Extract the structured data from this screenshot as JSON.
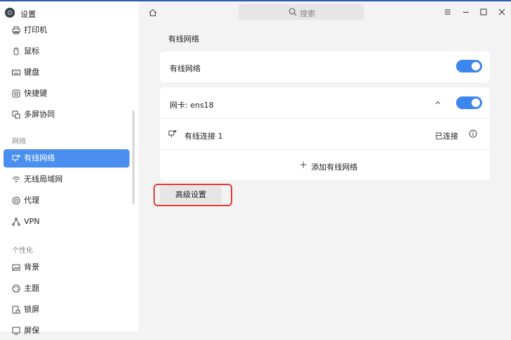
{
  "app": {
    "title": "设置",
    "icon": "settings-app-icon"
  },
  "search": {
    "placeholder": "搜索",
    "icon": "search-icon"
  },
  "sidebar": {
    "items_top": [
      {
        "label": "打印机",
        "icon": "printer-icon"
      },
      {
        "label": "鼠标",
        "icon": "mouse-icon"
      },
      {
        "label": "键盘",
        "icon": "keyboard-icon"
      },
      {
        "label": "快捷键",
        "icon": "shortcut-icon"
      },
      {
        "label": "多屏协同",
        "icon": "multi-screen-icon"
      }
    ],
    "section_network": "网络",
    "items_network": [
      {
        "label": "有线网络",
        "icon": "wired-network-icon",
        "active": true
      },
      {
        "label": "无线局域网",
        "icon": "wifi-icon"
      },
      {
        "label": "代理",
        "icon": "proxy-icon"
      },
      {
        "label": "VPN",
        "icon": "vpn-icon"
      }
    ],
    "section_personal": "个性化",
    "items_personal": [
      {
        "label": "背景",
        "icon": "background-icon"
      },
      {
        "label": "主题",
        "icon": "theme-icon"
      },
      {
        "label": "锁屏",
        "icon": "lock-screen-icon"
      },
      {
        "label": "屏保",
        "icon": "screensaver-icon"
      }
    ]
  },
  "main": {
    "title": "有线网络",
    "wired_toggle": {
      "label": "有线网络",
      "on": true
    },
    "nic": {
      "label": "网卡: ens18",
      "on": true
    },
    "connection": {
      "name": "有线连接 1",
      "status": "已连接"
    },
    "add_label": "添加有线网络",
    "advanced_label": "高级设置"
  },
  "colors": {
    "accent": "#4a8ff0",
    "highlight": "#e53935"
  }
}
